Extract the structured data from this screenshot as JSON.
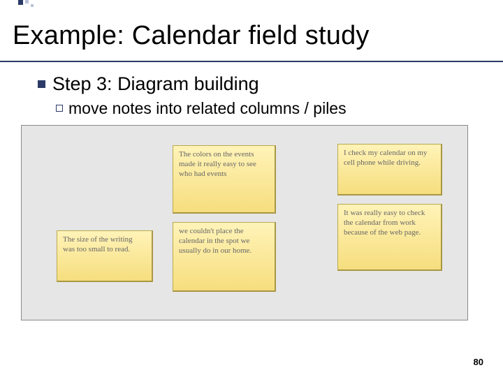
{
  "title": "Example: Calendar field study",
  "bullet1": "Step 3: Diagram building",
  "bullet2": "move notes into related columns / piles",
  "notes": {
    "n1": "The size of the writing was too small to read.",
    "n2": "The colors on the events made it really easy to see who had events",
    "n3": "we couldn't place the calendar in the spot we usually do in our home.",
    "n4": "I check my calendar on my cell phone while driving.",
    "n5": "It was really easy to check the calendar from work because of the web page."
  },
  "page_number": "80"
}
